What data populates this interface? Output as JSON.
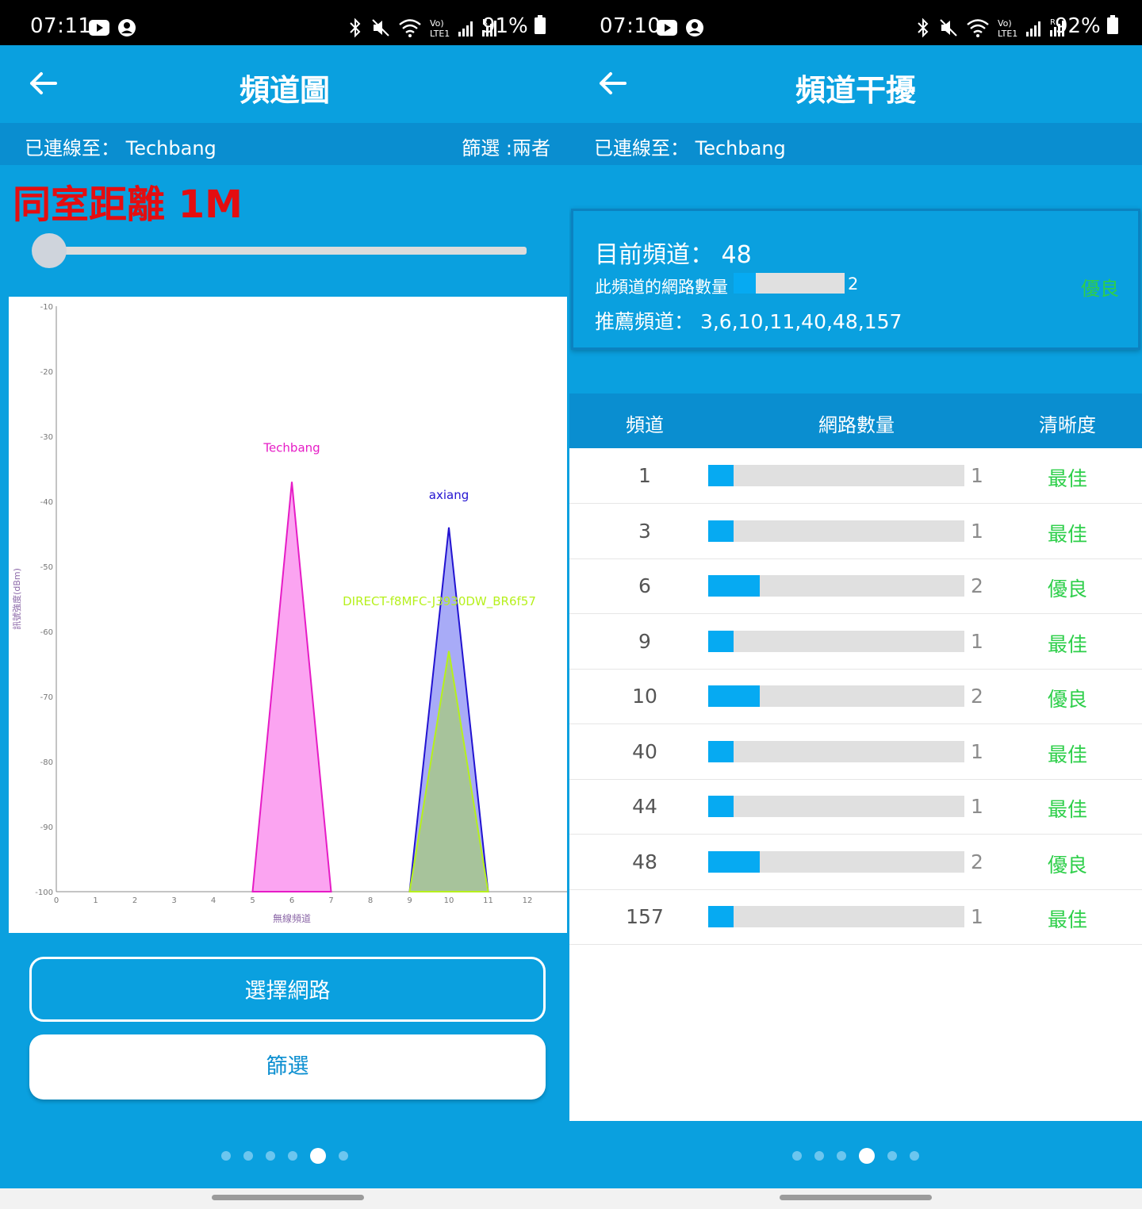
{
  "left": {
    "status_time": "07:11",
    "battery": "91%",
    "title": "頻道圖",
    "connected_label": "已連線至： Techbang",
    "filter_label": "篩選 :兩者",
    "annotation": "同室距離 1M",
    "slider_value": 0,
    "buttons": {
      "select_network": "選擇網路",
      "filter": "篩選"
    },
    "page_dots": 6,
    "active_dot": 4
  },
  "chart_data": {
    "type": "area",
    "title": "",
    "xlabel": "無線頻道",
    "ylabel": "訊號強度(dBm)",
    "xlim": [
      0,
      12
    ],
    "ylim": [
      -100,
      -10
    ],
    "x_ticks": [
      0,
      1,
      2,
      3,
      4,
      5,
      6,
      7,
      8,
      9,
      10,
      11,
      12
    ],
    "y_ticks": [
      -10,
      -20,
      -30,
      -40,
      -50,
      -60,
      -70,
      -80,
      -90,
      -100
    ],
    "series": [
      {
        "name": "Techbang",
        "channel": 6,
        "x": [
          5,
          6,
          7
        ],
        "y": [
          -100,
          -37,
          -100
        ],
        "fill": "#fb9ff0",
        "stroke": "#e61cc6"
      },
      {
        "name": "axiang",
        "channel": 10,
        "x": [
          9,
          10,
          11
        ],
        "y": [
          -100,
          -44,
          -100
        ],
        "fill": "#a3a6f7",
        "stroke": "#2313d1"
      },
      {
        "name": "DIRECT-f8MFC-J3930DW_BR6f57",
        "channel": 10,
        "x": [
          9,
          10,
          11
        ],
        "y": [
          -100,
          -63,
          -100
        ],
        "fill": "#a7c496",
        "stroke": "#b6f01c"
      }
    ]
  },
  "right": {
    "status_time": "07:10",
    "battery": "92%",
    "title": "頻道干擾",
    "connected_label": "已連線至： Techbang",
    "current_channel": "目前頻道： 48",
    "network_count_label": "此頻道的網路數量",
    "network_count": "2",
    "network_fraction": 0.2,
    "current_status": "優良",
    "recommended": "推薦頻道： 3,6,10,11,40,48,157",
    "table_headers": [
      "頻道",
      "網路數量",
      "清晰度"
    ],
    "max_count": 10,
    "rows": [
      {
        "channel": "1",
        "count": "1",
        "value": 1,
        "status": "最佳"
      },
      {
        "channel": "3",
        "count": "1",
        "value": 1,
        "status": "最佳"
      },
      {
        "channel": "6",
        "count": "2",
        "value": 2,
        "status": "優良"
      },
      {
        "channel": "9",
        "count": "1",
        "value": 1,
        "status": "最佳"
      },
      {
        "channel": "10",
        "count": "2",
        "value": 2,
        "status": "優良"
      },
      {
        "channel": "40",
        "count": "1",
        "value": 1,
        "status": "最佳"
      },
      {
        "channel": "44",
        "count": "1",
        "value": 1,
        "status": "最佳"
      },
      {
        "channel": "48",
        "count": "2",
        "value": 2,
        "status": "優良"
      },
      {
        "channel": "157",
        "count": "1",
        "value": 1,
        "status": "最佳"
      }
    ],
    "page_dots": 6,
    "active_dot": 3
  },
  "colors": {
    "primary": "#0aa0df",
    "header": "#0a8ed0",
    "good": "#2ecf4a",
    "bar": "#06aaf2",
    "annotation": "#e40d10"
  }
}
